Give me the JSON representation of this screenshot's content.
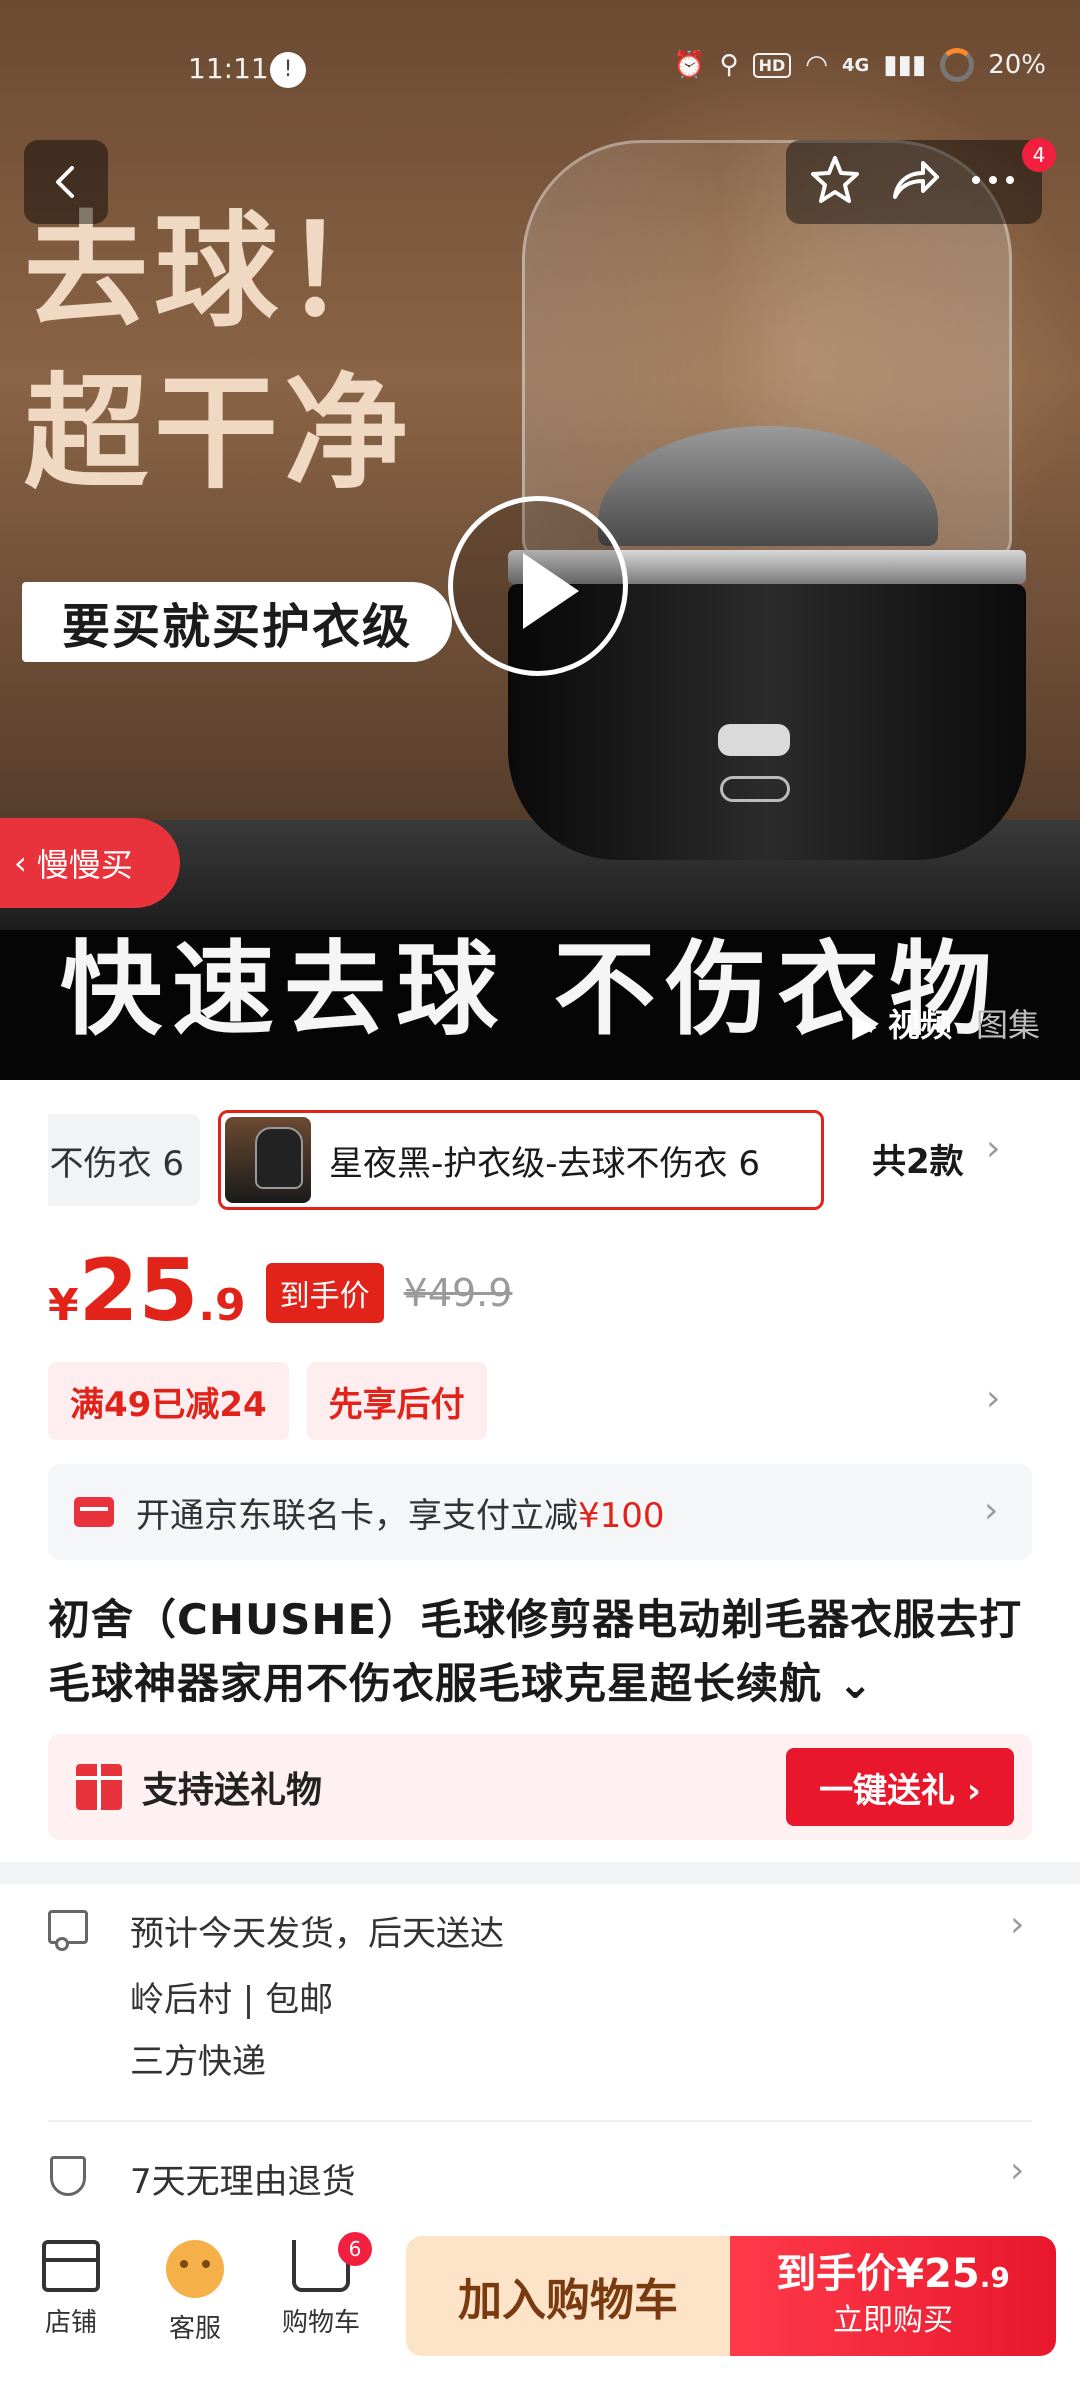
{
  "status_bar": {
    "time": "11:11",
    "notification_dot": "!",
    "network": "4G",
    "hd_label": "HD",
    "battery": "20%"
  },
  "top_bar": {
    "notification_count": "4"
  },
  "hero": {
    "headline_1": "去球！",
    "headline_2": "超干净",
    "tagline": "要买就买护衣级",
    "bottom_text": "快速去球 不伤衣物",
    "slow_buy_label": "慢慢买",
    "tab_video": "视频",
    "tab_gallery": "图集"
  },
  "variants": {
    "prev_label": "不伤衣 6",
    "selected_label": "星夜黑-护衣级-去球不伤衣 6",
    "count_label": "共2款"
  },
  "price": {
    "symbol": "¥",
    "integer": "25",
    "decimal": ".9",
    "tag": "到手价",
    "original": "¥49.9"
  },
  "promos": [
    "满49已减24",
    "先享后付"
  ],
  "card_promo": {
    "text": "开通京东联名卡，享支付立减",
    "amount": "¥100"
  },
  "product_title": "初舍（CHUSHE）毛球修剪器电动剃毛器衣服去打毛球神器家用不伤衣服毛球克星超长续航 ⌄",
  "gift": {
    "label": "支持送礼物",
    "button": "一键送礼 ›"
  },
  "shipping": {
    "line1": "预计今天发货，后天送达",
    "line2": "岭后村 | 包邮",
    "line3": "三方快递"
  },
  "returns": {
    "label": "7天无理由退货"
  },
  "bottom_bar": {
    "store_label": "店铺",
    "service_label": "客服",
    "cart_label": "购物车",
    "cart_count": "6",
    "add_to_cart": "加入购物车",
    "buy_price_prefix": "到手价",
    "buy_price": "¥25",
    "buy_price_dec": ".9",
    "buy_now": "立即购买"
  },
  "colors": {
    "accent_red": "#e2231a",
    "button_red": "#e8172c",
    "add_cart_bg": "#fde3c8"
  }
}
